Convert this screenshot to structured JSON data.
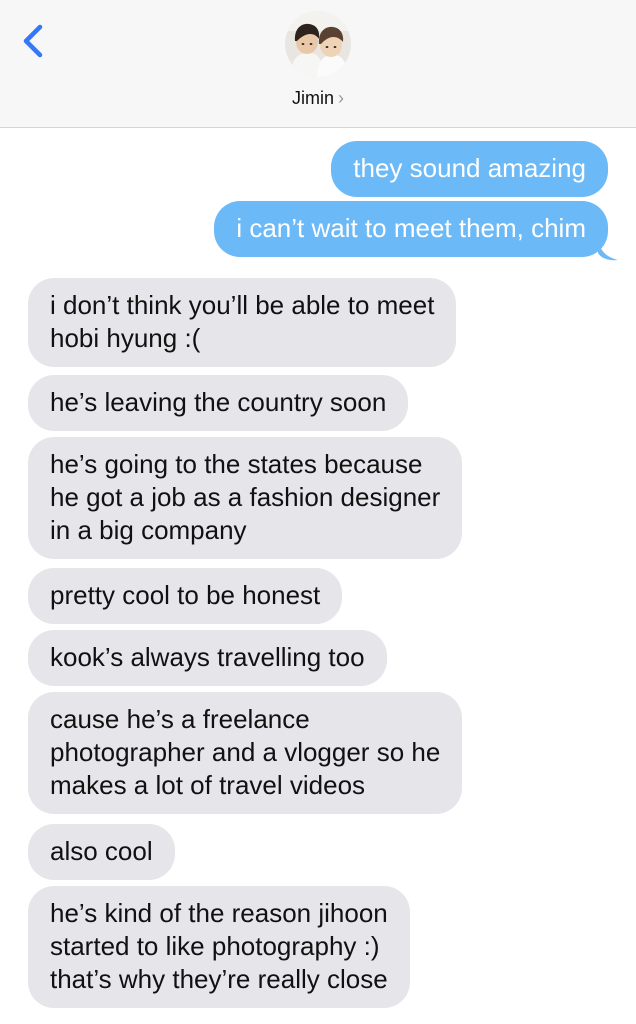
{
  "header": {
    "contact_name": "Jimin",
    "contact_chevron": "›",
    "back_icon": "chevron-left-icon",
    "accent_color": "#3478f6"
  },
  "colors": {
    "sent_bubble": "#6cb9f7",
    "received_bubble": "#e6e6ea"
  },
  "messages": [
    {
      "direction": "sent",
      "text": "they sound amazing"
    },
    {
      "direction": "sent",
      "text": "i can’t wait to meet them, chim"
    },
    {
      "direction": "received",
      "text": "i don’t think you’ll be able to meet\nhobi hyung :("
    },
    {
      "direction": "received",
      "text": "he’s leaving the country soon"
    },
    {
      "direction": "received",
      "text": "he’s going to the states because\nhe got a job as a fashion designer\nin a big company"
    },
    {
      "direction": "received",
      "text": "pretty cool to be honest"
    },
    {
      "direction": "received",
      "text": "kook’s always travelling too"
    },
    {
      "direction": "received",
      "text": "cause he’s a freelance\nphotographer and a vlogger so he\nmakes a lot of travel videos"
    },
    {
      "direction": "received",
      "text": "also cool"
    },
    {
      "direction": "received",
      "text": "he’s kind of the reason jihoon\nstarted to like photography :)\nthat’s why they’re really close"
    }
  ]
}
